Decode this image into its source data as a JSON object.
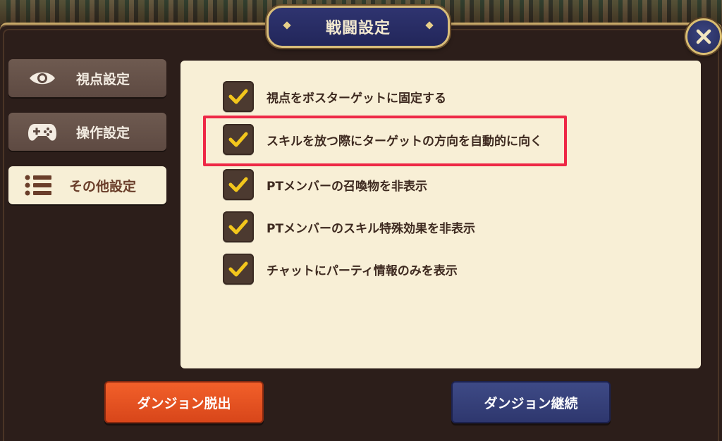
{
  "title": "戦闘設定",
  "close_symbol": "✕",
  "tabs": [
    {
      "label": "視点設定",
      "icon": "eye-icon",
      "active": false
    },
    {
      "label": "操作設定",
      "icon": "gamepad-icon",
      "active": false
    },
    {
      "label": "その他設定",
      "icon": "list-icon",
      "active": true
    }
  ],
  "options": [
    {
      "label": "視点をボスターゲットに固定する",
      "checked": true
    },
    {
      "label": "スキルを放つ際にターゲットの方向を自動的に向く",
      "checked": true,
      "highlighted": true
    },
    {
      "label": "PTメンバーの召喚物を非表示",
      "checked": true
    },
    {
      "label": "PTメンバーのスキル特殊効果を非表示",
      "checked": true
    },
    {
      "label": "チャットにパーティ情報のみを表示",
      "checked": true
    }
  ],
  "buttons": {
    "exit_label": "ダンジョン脱出",
    "continue_label": "ダンジョン継続"
  },
  "colors": {
    "check_mark": "#f2c61c",
    "highlight": "#ee2846",
    "exit_button": "#e8521f",
    "continue_button": "#36407a"
  }
}
